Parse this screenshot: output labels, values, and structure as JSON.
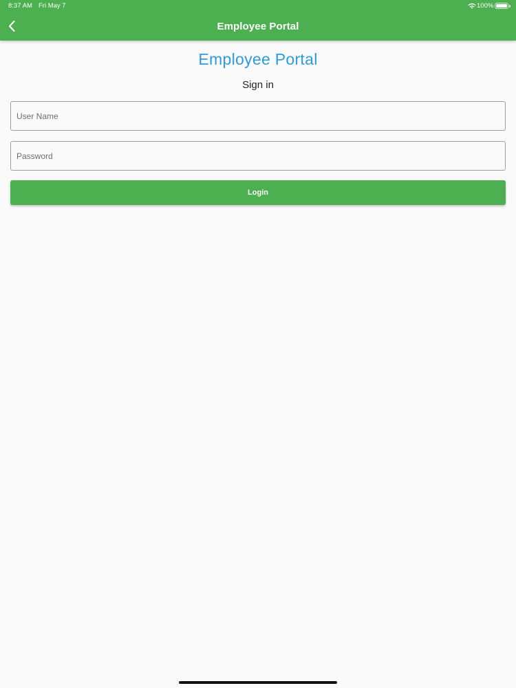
{
  "status_bar": {
    "time": "8:37 AM",
    "date": "Fri May 7",
    "battery_percent": "100%",
    "battery_level": 1.0,
    "icons": [
      "wifi-icon",
      "battery-icon"
    ]
  },
  "app_bar": {
    "title": "Employee Portal",
    "back_icon": "chevron-left-icon",
    "color": "#4caf50"
  },
  "main": {
    "heading": "Employee Portal",
    "heading_color": "#2c9be0",
    "subheading": "Sign in",
    "username_placeholder": "User Name",
    "username_value": "",
    "password_placeholder": "Password",
    "password_value": "",
    "login_label": "Login",
    "login_color": "#4caf50"
  }
}
